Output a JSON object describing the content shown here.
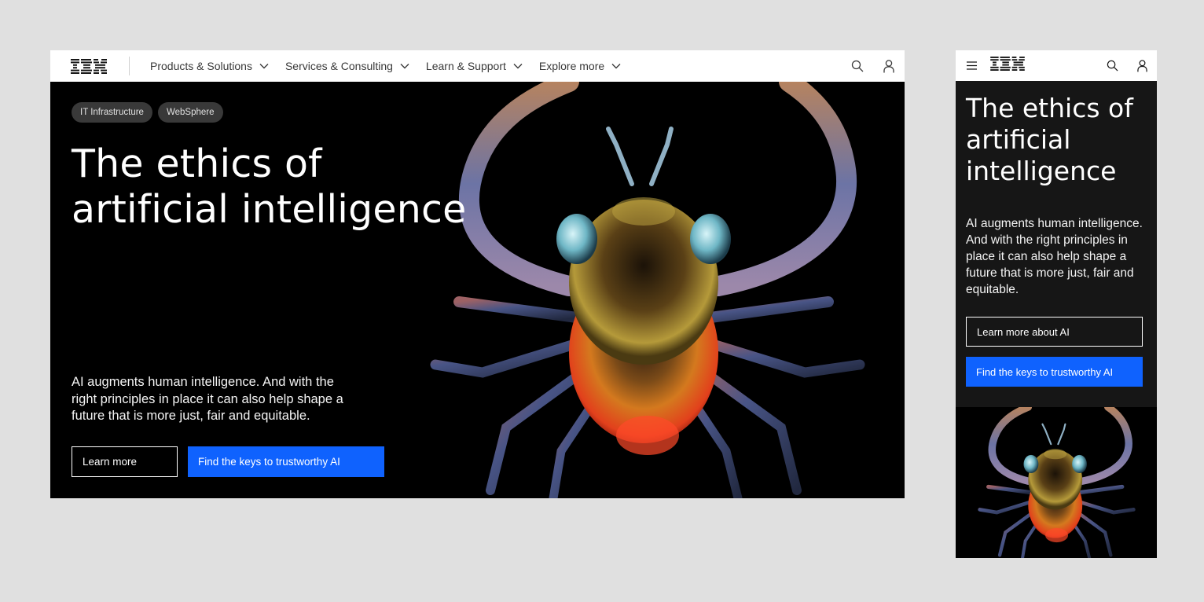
{
  "brand": {
    "logo_text": "IBM",
    "accent_color": "#0f62fe"
  },
  "desktop": {
    "nav": {
      "items": [
        {
          "label": "Products & Solutions"
        },
        {
          "label": "Services & Consulting"
        },
        {
          "label": "Learn & Support"
        },
        {
          "label": "Explore more"
        }
      ],
      "icons": [
        "search-icon",
        "user-icon"
      ]
    },
    "tags": [
      "IT Infrastructure",
      "WebSphere"
    ],
    "title": "The ethics of artificial intelligence",
    "description": "AI augments human intelligence. And with the right principles in place it can also help shape a future that is more just, fair and equitable.",
    "buttons": {
      "secondary": "Learn more",
      "primary": "Find the keys to trustworthy AI"
    }
  },
  "mobile": {
    "nav": {
      "icons": [
        "menu-icon",
        "search-icon",
        "user-icon"
      ]
    },
    "title": "The ethics of artificial intelligence",
    "description": "AI augments human intelligence. And with the right principles in place it can also help shape a future that is more just, fair and equitable.",
    "buttons": {
      "secondary": "Learn more about AI",
      "primary": "Find the keys to trustworthy AI"
    }
  }
}
